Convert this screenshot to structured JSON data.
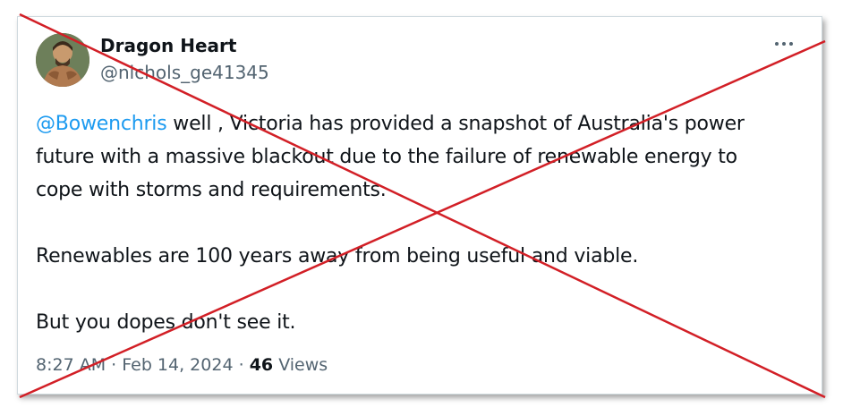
{
  "tweet": {
    "author_name": "Dragon Heart",
    "author_handle": "@nichols_ge41345",
    "mention": "@Bowenchris",
    "line1_rest": " well , Victoria has provided a snapshot of Australia's power",
    "line2": "future with a massive blackout due to the failure of renewable energy to",
    "line3": "cope with storms and requirements.",
    "para2": "Renewables are 100 years away from being useful and viable.",
    "para3": "But you dopes don't see it.",
    "time": "8:27 AM",
    "separator": "·",
    "date": "Feb 14, 2024",
    "views_count": "46",
    "views_label": "Views"
  },
  "icons": {
    "more": "more-horizontal-icon",
    "avatar": "profile-avatar"
  },
  "colors": {
    "mention": "#1d9bf0",
    "secondary_text": "#536471",
    "primary_text": "#0f1419",
    "cross_overlay": "#d21f26"
  }
}
